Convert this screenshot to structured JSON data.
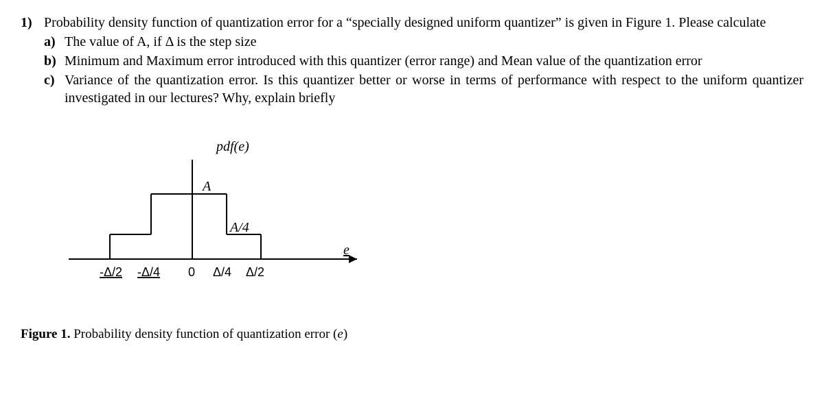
{
  "question": {
    "number": "1)",
    "intro": "Probability density function of quantization error for a “specially designed uniform quantizer” is given in Figure 1. Please calculate",
    "parts": [
      {
        "letter": "a)",
        "text": "The value of A, if Δ is the step size"
      },
      {
        "letter": "b)",
        "text": "Minimum and Maximum error introduced with this quantizer (error range) and Mean value of the quantization error"
      },
      {
        "letter": "c)",
        "text": "Variance of the quantization error. Is this quantizer better or worse in terms of performance with respect to the uniform quantizer investigated in our lectures? Why, explain briefly"
      }
    ]
  },
  "figure": {
    "ylabel": "pdf(e)",
    "xlabel": "e",
    "level_high": "A",
    "level_low": "A/4",
    "xticks": [
      "-Δ/2",
      "-Δ/4",
      "0",
      "Δ/4",
      "Δ/2"
    ],
    "caption_num": "Figure 1.",
    "caption_text": "Probability density function of quantization error (",
    "caption_var": "e",
    "caption_close": ")"
  },
  "chart_data": {
    "type": "bar",
    "title": "pdf(e)",
    "xlabel": "e",
    "ylabel": "pdf(e)",
    "x_breakpoints": [
      "-Δ/2",
      "-Δ/4",
      "0",
      "Δ/4",
      "Δ/2"
    ],
    "segments": [
      {
        "from": "-Δ/2",
        "to": "-Δ/4",
        "height": "A/4"
      },
      {
        "from": "-Δ/4",
        "to": "0",
        "height": "A"
      },
      {
        "from": "0",
        "to": "Δ/4",
        "height": "A"
      },
      {
        "from": "Δ/4",
        "to": "Δ/2",
        "height": "A/4"
      }
    ],
    "notes": "Step function symmetric about 0; outer segments at A/4, inner segments at A; outside [-Δ/2, Δ/2] pdf is 0."
  }
}
